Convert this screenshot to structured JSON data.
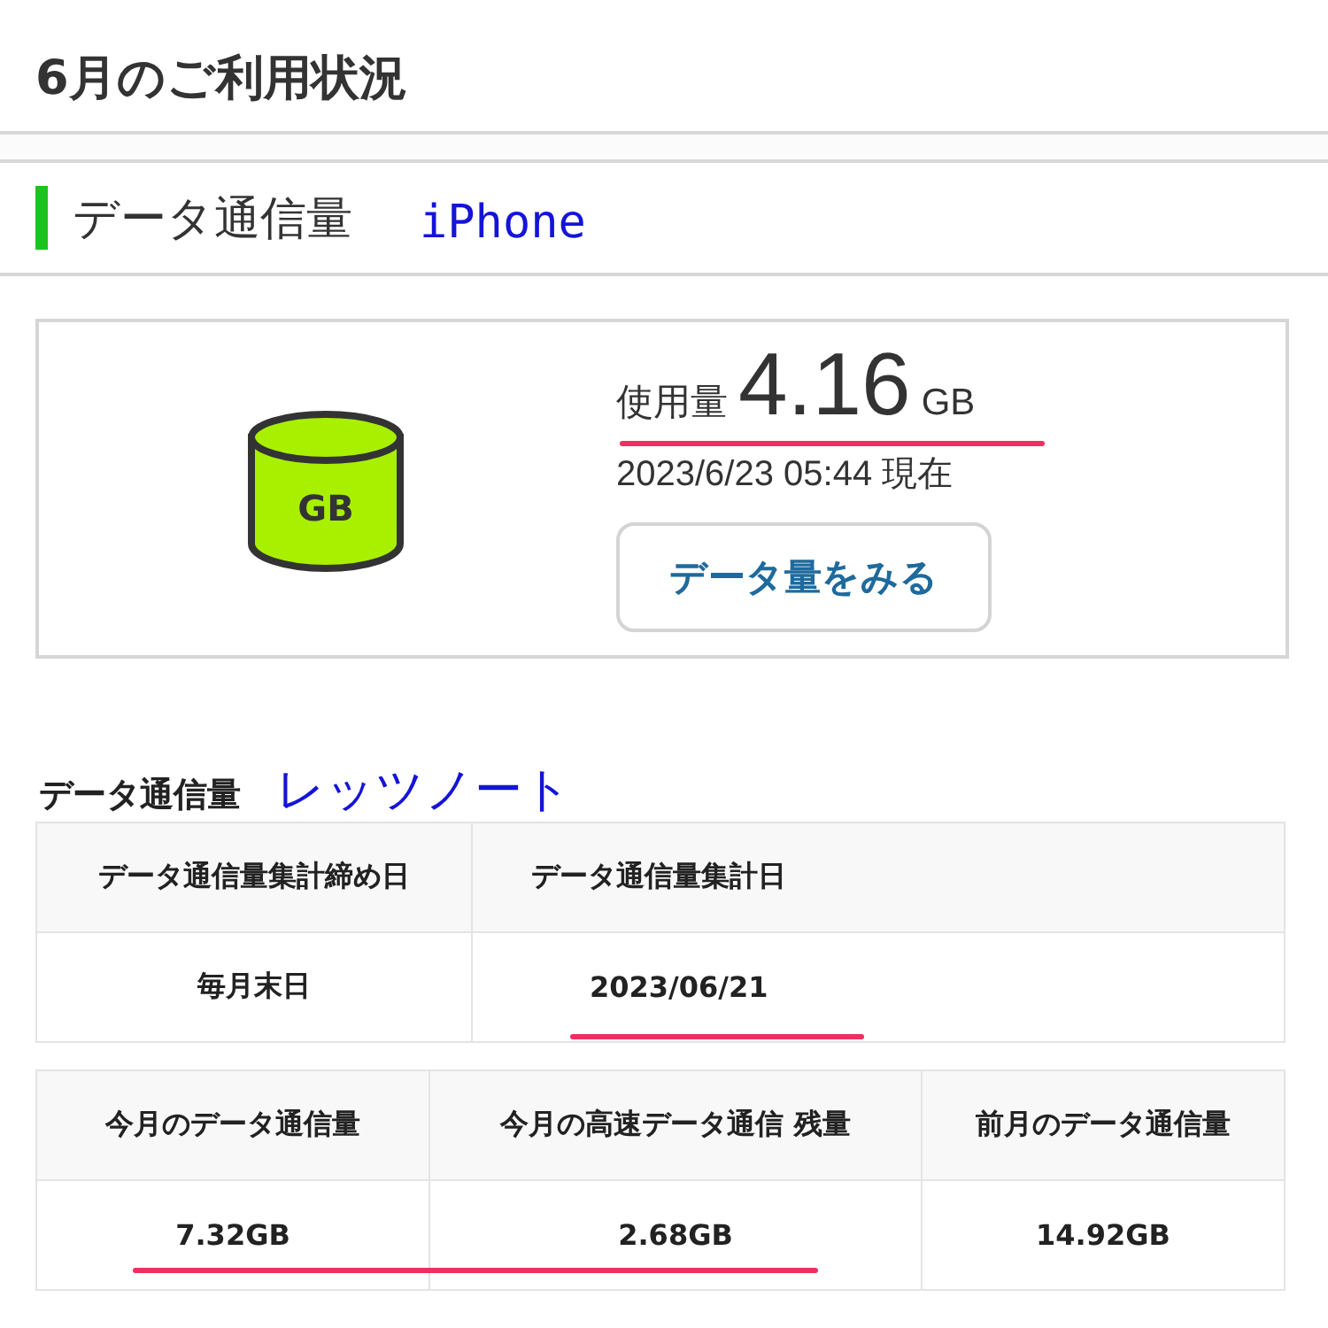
{
  "page_title": "6月のご利用状況",
  "section": {
    "title": "データ通信量",
    "device_note": "iPhone"
  },
  "usage_card": {
    "label": "使用量",
    "amount": "4.16",
    "unit": "GB",
    "icon_text": "GB",
    "timestamp": "2023/6/23 05:44 現在",
    "button": "データ量をみる"
  },
  "detail": {
    "title": "データ通信量",
    "device_note": "レッツノート",
    "tables": [
      {
        "kind": "two",
        "columns": [
          "データ通信量集計締め日",
          "データ通信量集計日"
        ],
        "rows": [
          [
            "毎月末日",
            "2023/06/21"
          ]
        ]
      },
      {
        "kind": "three",
        "columns": [
          "今月のデータ通信量",
          "今月の高速データ通信 残量",
          "前月のデータ通信量"
        ],
        "rows": [
          [
            "7.32GB",
            "2.68GB",
            "14.92GB"
          ]
        ]
      }
    ]
  }
}
